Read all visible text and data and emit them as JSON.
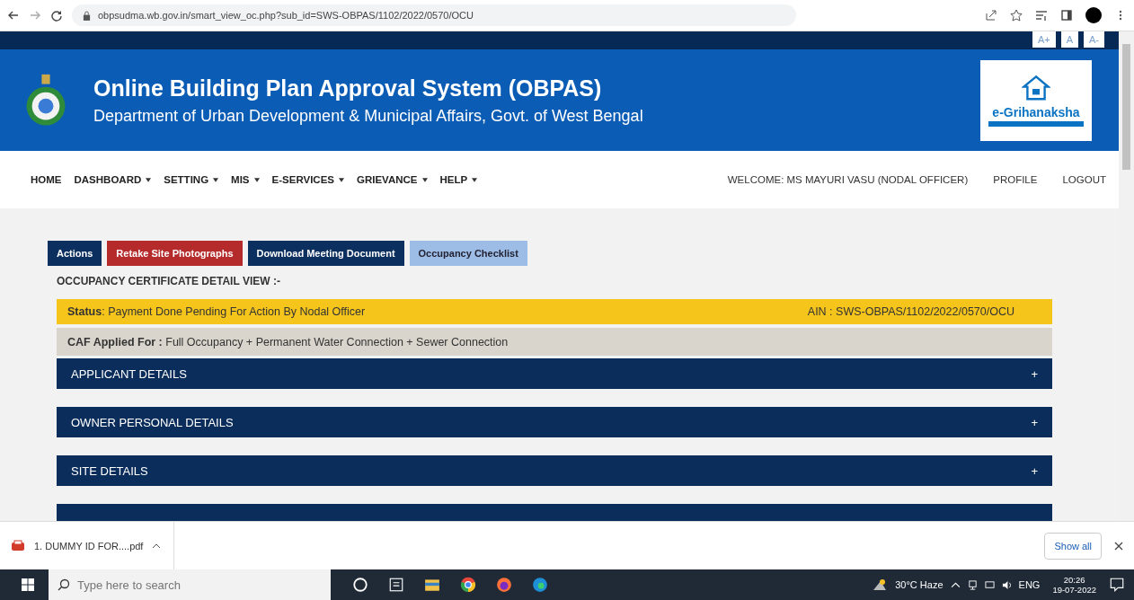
{
  "browser": {
    "url": "obpsudma.wb.gov.in/smart_view_oc.php?sub_id=SWS-OBPAS/1102/2022/0570/OCU"
  },
  "font_buttons": [
    "A+",
    "A",
    "A-"
  ],
  "header": {
    "title": "Online Building Plan Approval System (OBPAS)",
    "subtitle": "Department of Urban Development & Municipal Affairs, Govt. of West Bengal",
    "logo_text": "e-Grihanaksha"
  },
  "nav": [
    {
      "label": "HOME",
      "dropdown": false
    },
    {
      "label": "DASHBOARD",
      "dropdown": true
    },
    {
      "label": "SETTING",
      "dropdown": true
    },
    {
      "label": "MIS",
      "dropdown": true
    },
    {
      "label": "E-SERVICES",
      "dropdown": true
    },
    {
      "label": "GRIEVANCE",
      "dropdown": true
    },
    {
      "label": "HELP",
      "dropdown": true
    }
  ],
  "user": {
    "welcome": "WELCOME: MS MAYURI VASU (NODAL OFFICER)",
    "links": [
      "PROFILE",
      "LOGOUT"
    ]
  },
  "action_buttons": [
    {
      "label": "Actions",
      "kind": "dark"
    },
    {
      "label": "Retake Site Photographs",
      "kind": "red"
    },
    {
      "label": "Download Meeting Document",
      "kind": "dark"
    },
    {
      "label": "Occupancy Checklist",
      "kind": "light"
    }
  ],
  "section_title": "OCCUPANCY CERTIFICATE DETAIL VIEW :-",
  "status": {
    "text": "**Status**: Payment Done Pending For Action By Nodal Officer",
    "ain": "AIN : SWS-OBPAS/1102/2022/0570/OCU"
  },
  "caf": {
    "text": "**CAF Applied For :** Full Occupancy + Permanent Water Connection + Sewer Connection"
  },
  "accordions": [
    {
      "title": "APPLICANT DETAILS",
      "toggle": "+"
    },
    {
      "title": "OWNER PERSONAL DETAILS",
      "toggle": "+"
    },
    {
      "title": "SITE DETAILS",
      "toggle": "+"
    }
  ],
  "download": {
    "file": "1. DUMMY ID FOR....pdf",
    "show_all": "Show all"
  },
  "taskbar": {
    "search_placeholder": "Type here to search",
    "weather": "30°C  Haze",
    "language": "ENG",
    "time": "20:26",
    "date": "19-07-2022"
  }
}
